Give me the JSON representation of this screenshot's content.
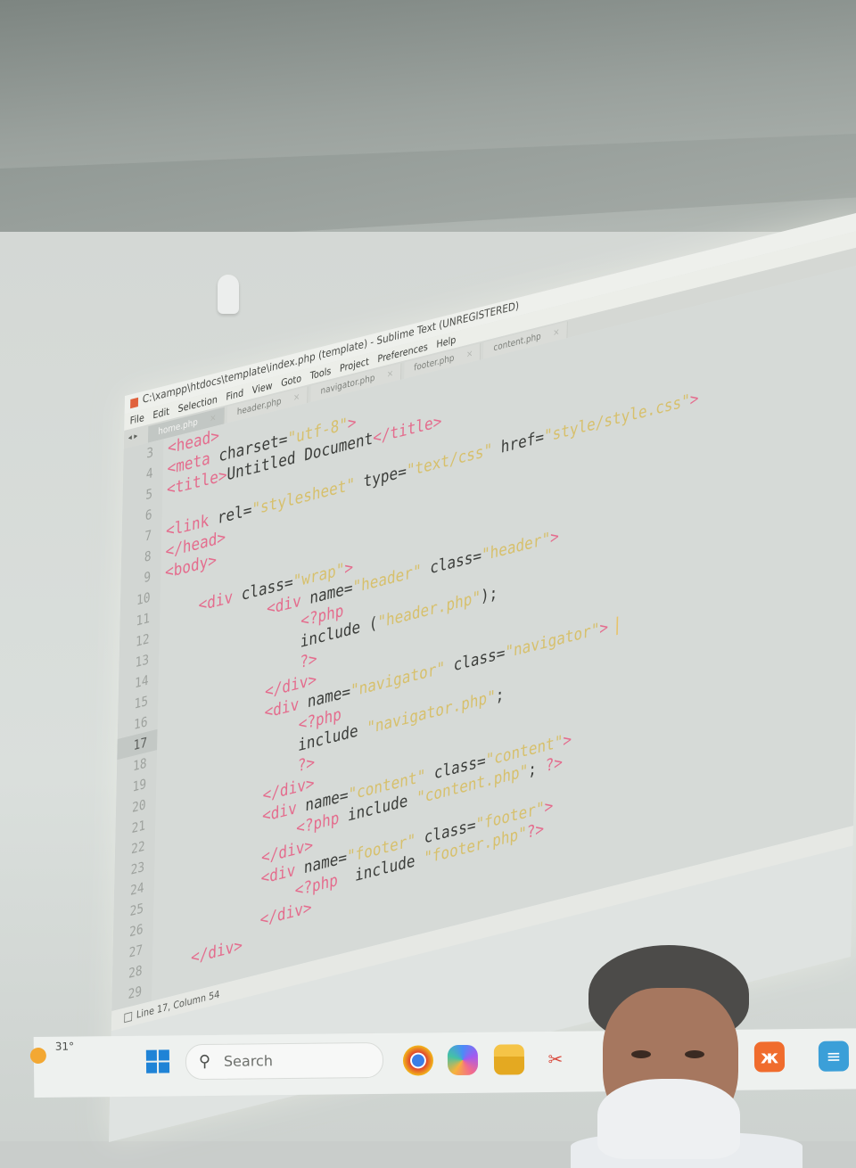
{
  "window": {
    "title": "C:\\xampp\\htdocs\\template\\index.php (template) - Sublime Text (UNREGISTERED)"
  },
  "menu": [
    "File",
    "Edit",
    "Selection",
    "Find",
    "View",
    "Goto",
    "Tools",
    "Project",
    "Preferences",
    "Help"
  ],
  "tabs": [
    {
      "label": "home.php",
      "active": true
    },
    {
      "label": "header.php",
      "active": false
    },
    {
      "label": "navigator.php",
      "active": false
    },
    {
      "label": "footer.php",
      "active": false
    },
    {
      "label": "content.php",
      "active": false
    }
  ],
  "editor": {
    "current_line": 17,
    "lines": [
      {
        "n": "3",
        "code": "<head>"
      },
      {
        "n": "4",
        "code": "<meta charset=\"utf-8\">"
      },
      {
        "n": "5",
        "code": "<title>Untitled Document</title>"
      },
      {
        "n": "6",
        "code": ""
      },
      {
        "n": "7",
        "code": "<link rel=\"stylesheet\" type=\"text/css\" href=\"style/style.css\">"
      },
      {
        "n": "8",
        "code": "</head>"
      },
      {
        "n": "9",
        "code": "<body>"
      },
      {
        "n": "10",
        "code": ""
      },
      {
        "n": "11",
        "code": "    <div class=\"wrap\">"
      },
      {
        "n": "12",
        "code": "            <div name=\"header\" class=\"header\">"
      },
      {
        "n": "13",
        "code": "                <?php"
      },
      {
        "n": "14",
        "code": "                include (\"header.php\");"
      },
      {
        "n": "15",
        "code": "                ?>"
      },
      {
        "n": "16",
        "code": "            </div>"
      },
      {
        "n": "17",
        "code": "            <div name=\"navigator\" class=\"navigator\">"
      },
      {
        "n": "18",
        "code": "                <?php"
      },
      {
        "n": "19",
        "code": "                include \"navigator.php\";"
      },
      {
        "n": "20",
        "code": "                ?>"
      },
      {
        "n": "21",
        "code": "            </div>"
      },
      {
        "n": "22",
        "code": "            <div name=\"content\" class=\"content\">"
      },
      {
        "n": "23",
        "code": "                <?php include \"content.php\"; ?>"
      },
      {
        "n": "24",
        "code": "            </div>"
      },
      {
        "n": "25",
        "code": "            <div name=\"footer\" class=\"footer\">"
      },
      {
        "n": "26",
        "code": "                <?php  include \"footer.php\"?>"
      },
      {
        "n": "27",
        "code": "            </div>"
      },
      {
        "n": "28",
        "code": "    </div>"
      },
      {
        "n": "29",
        "code": ""
      }
    ]
  },
  "statusbar": {
    "position": "Line 17, Column 54"
  },
  "taskbar": {
    "temperature": "31°",
    "search_placeholder": "Search",
    "apps": [
      "chrome-icon",
      "copilot-icon",
      "file-explorer-icon",
      "snipping-tool-icon",
      "xampp-icon",
      "notepad-icon"
    ]
  }
}
